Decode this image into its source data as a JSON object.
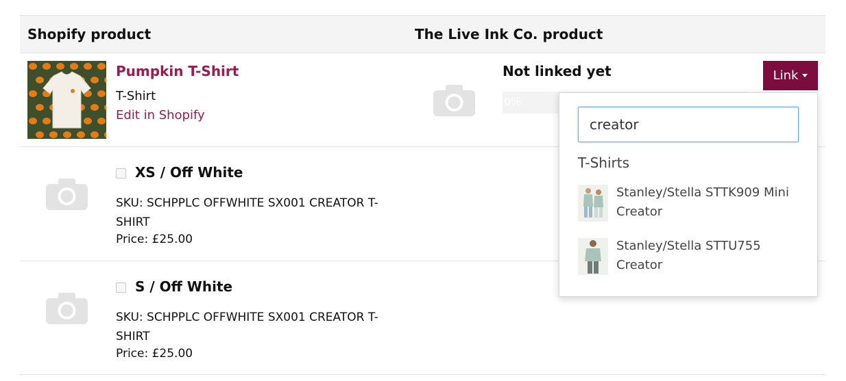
{
  "headers": {
    "shopify": "Shopify product",
    "liveink": "The Live Ink Co. product"
  },
  "product": {
    "title": "Pumpkin T-Shirt",
    "type": "T-Shirt",
    "edit_link": "Edit in Shopify",
    "link_status": "Not linked yet",
    "progress_label": "0%",
    "progress_value": 0,
    "link_button": "Link"
  },
  "variants": [
    {
      "title": "XS / Off White",
      "sku": "SKU: SCHPPLC OFFWHITE SX001 CREATOR T-SHIRT",
      "price": "Price: £25.00"
    },
    {
      "title": "S / Off White",
      "sku": "SKU: SCHPPLC OFFWHITE SX001 CREATOR T-SHIRT",
      "price": "Price: £25.00"
    }
  ],
  "dropdown": {
    "search_value": "creator",
    "group_label": "T-Shirts",
    "options": [
      {
        "label": "Stanley/Stella STTK909 Mini Creator"
      },
      {
        "label": "Stanley/Stella STTU755 Creator"
      }
    ]
  },
  "colors": {
    "accent": "#9a1c50",
    "button": "#7c0c3e",
    "header_bg": "#f4f4f4",
    "placeholder_icon": "#e3e3e3",
    "thumb_bg": "#3e4f2b",
    "pumpkin": "#e57b17"
  },
  "icons": [
    "camera-placeholder-icon",
    "chevron-down-icon"
  ]
}
